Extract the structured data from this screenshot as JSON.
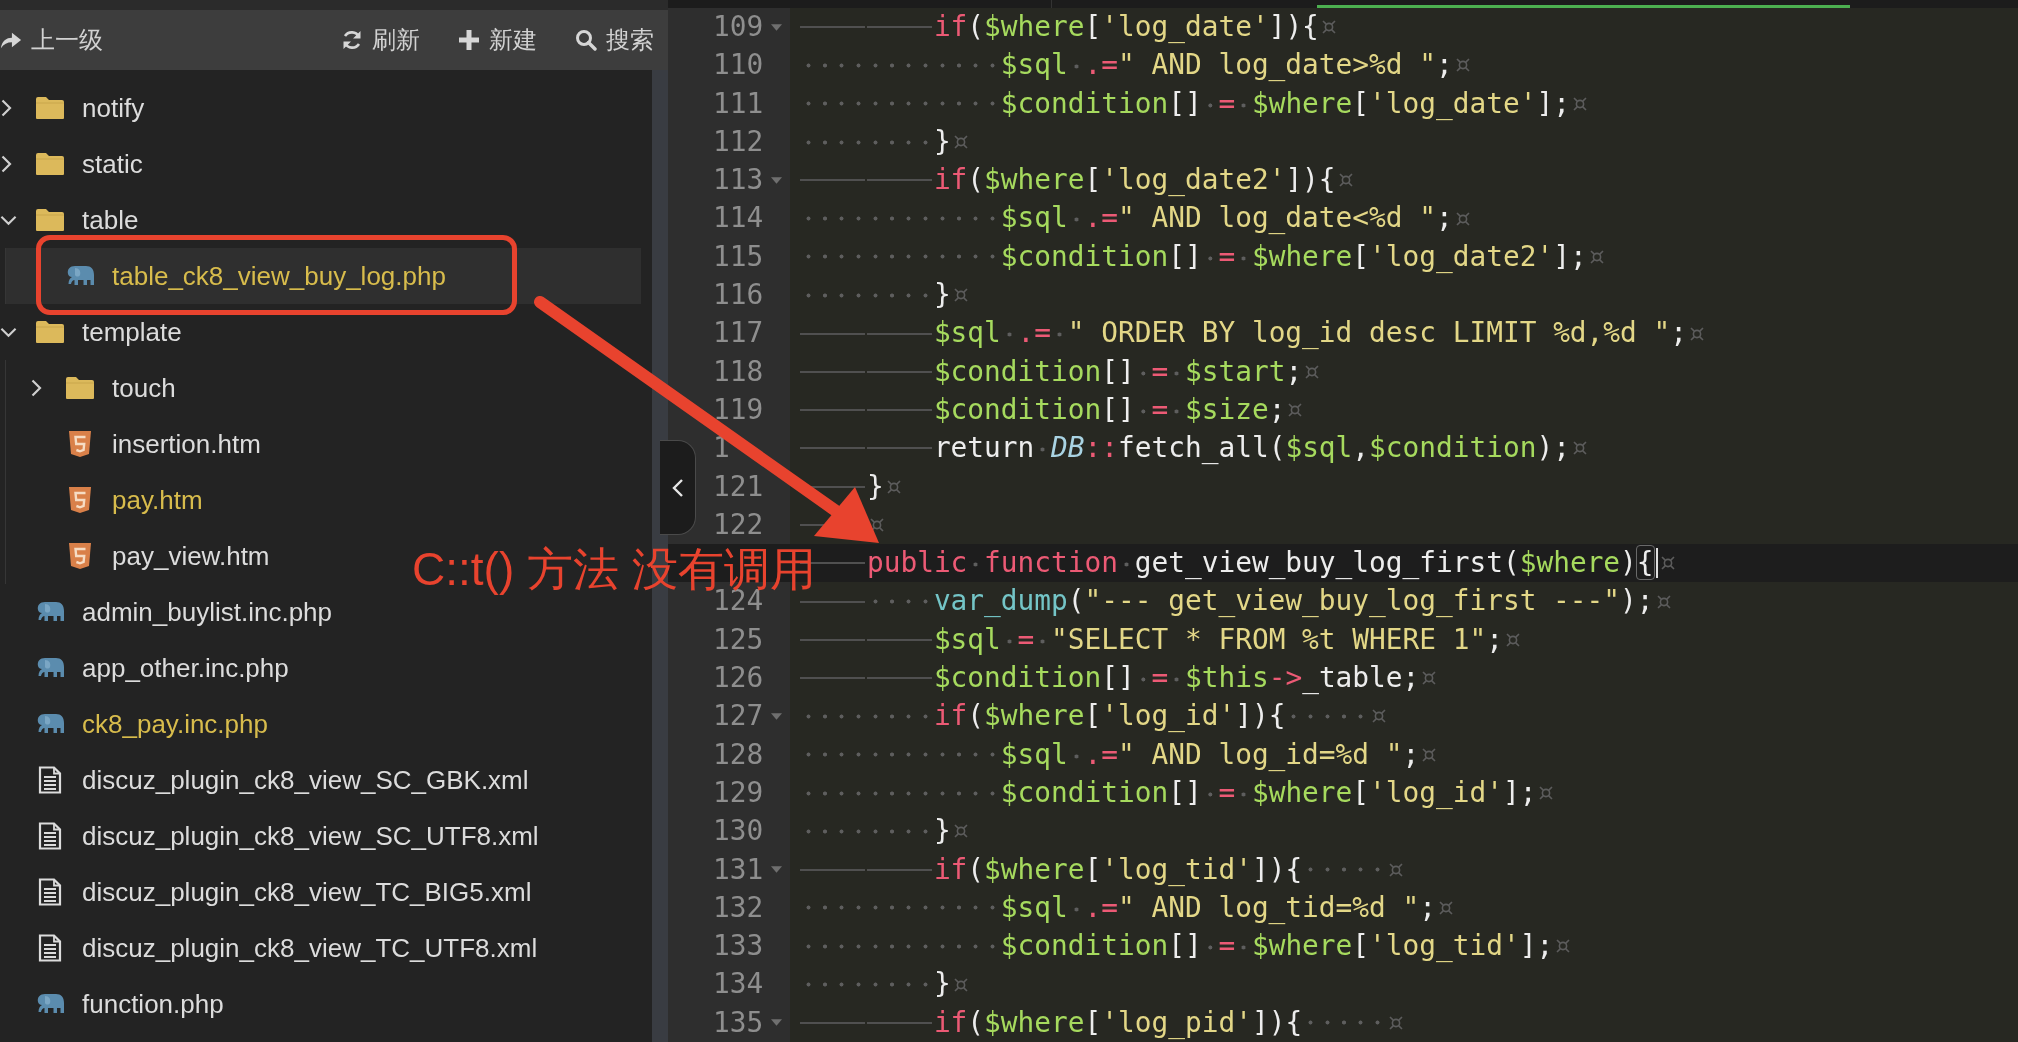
{
  "toolbar": {
    "actions": [
      {
        "kind": "up",
        "label": "上一级"
      },
      {
        "kind": "refresh",
        "label": "刷新"
      },
      {
        "kind": "new",
        "label": "新建"
      },
      {
        "kind": "search",
        "label": "搜索"
      }
    ]
  },
  "tree": [
    {
      "kind": "folder",
      "name": "notify",
      "expanded": false,
      "selected": false,
      "modified": false
    },
    {
      "kind": "folder",
      "name": "static",
      "expanded": false,
      "selected": false,
      "modified": false
    },
    {
      "kind": "folder",
      "name": "table",
      "expanded": true,
      "selected": false,
      "modified": false,
      "children": [
        {
          "kind": "php",
          "name": "table_ck8_view_buy_log.php",
          "selected": true,
          "modified": true
        }
      ]
    },
    {
      "kind": "folder",
      "name": "template",
      "expanded": true,
      "selected": false,
      "modified": false,
      "children": [
        {
          "kind": "folder",
          "name": "touch",
          "expanded": false,
          "selected": false,
          "modified": false
        },
        {
          "kind": "html",
          "name": "insertion.htm",
          "selected": false,
          "modified": false
        },
        {
          "kind": "html",
          "name": "pay.htm",
          "selected": false,
          "modified": true
        },
        {
          "kind": "html",
          "name": "pay_view.htm",
          "selected": false,
          "modified": false
        }
      ]
    },
    {
      "kind": "php",
      "name": "admin_buylist.inc.php",
      "selected": false,
      "modified": false
    },
    {
      "kind": "php",
      "name": "app_other.inc.php",
      "selected": false,
      "modified": false
    },
    {
      "kind": "php",
      "name": "ck8_pay.inc.php",
      "selected": false,
      "modified": true
    },
    {
      "kind": "xml",
      "name": "discuz_plugin_ck8_view_SC_GBK.xml",
      "selected": false,
      "modified": false
    },
    {
      "kind": "xml",
      "name": "discuz_plugin_ck8_view_SC_UTF8.xml",
      "selected": false,
      "modified": false
    },
    {
      "kind": "xml",
      "name": "discuz_plugin_ck8_view_TC_BIG5.xml",
      "selected": false,
      "modified": false
    },
    {
      "kind": "xml",
      "name": "discuz_plugin_ck8_view_TC_UTF8.xml",
      "selected": false,
      "modified": false
    },
    {
      "kind": "php",
      "name": "function.php",
      "selected": false,
      "modified": false
    }
  ],
  "editor": {
    "show_invisibles": true,
    "lines": [
      {
        "number": "109",
        "foldable": true,
        "active": false,
        "indent": [
          {
            "kind": "tab"
          },
          {
            "kind": "tab"
          }
        ],
        "tokens": [
          {
            "kind": "kw",
            "text": "if"
          },
          {
            "kind": "punc",
            "text": "("
          },
          {
            "kind": "var",
            "text": "$where"
          },
          {
            "kind": "punc",
            "text": "["
          },
          {
            "kind": "str",
            "text": "'log_date'"
          },
          {
            "kind": "punc",
            "text": "]){"
          }
        ]
      },
      {
        "number": "110",
        "foldable": false,
        "active": false,
        "indent": [
          {
            "kind": "space"
          },
          {
            "kind": "space"
          },
          {
            "kind": "space"
          },
          {
            "kind": "space"
          },
          {
            "kind": "space"
          },
          {
            "kind": "space"
          },
          {
            "kind": "space"
          },
          {
            "kind": "space"
          },
          {
            "kind": "space"
          },
          {
            "kind": "space"
          },
          {
            "kind": "space"
          },
          {
            "kind": "space"
          }
        ],
        "tokens": [
          {
            "kind": "var",
            "text": "$sql"
          },
          {
            "kind": "space"
          },
          {
            "kind": "op",
            "text": ".="
          },
          {
            "kind": "str",
            "text": "\" AND log_date>%d \""
          },
          {
            "kind": "punc",
            "text": ";"
          }
        ]
      },
      {
        "number": "111",
        "foldable": false,
        "active": false,
        "indent": [
          {
            "kind": "space"
          },
          {
            "kind": "space"
          },
          {
            "kind": "space"
          },
          {
            "kind": "space"
          },
          {
            "kind": "space"
          },
          {
            "kind": "space"
          },
          {
            "kind": "space"
          },
          {
            "kind": "space"
          },
          {
            "kind": "space"
          },
          {
            "kind": "space"
          },
          {
            "kind": "space"
          },
          {
            "kind": "space"
          }
        ],
        "tokens": [
          {
            "kind": "var",
            "text": "$condition"
          },
          {
            "kind": "punc",
            "text": "[]"
          },
          {
            "kind": "space"
          },
          {
            "kind": "op",
            "text": "="
          },
          {
            "kind": "space"
          },
          {
            "kind": "var",
            "text": "$where"
          },
          {
            "kind": "punc",
            "text": "["
          },
          {
            "kind": "str",
            "text": "'log_date'"
          },
          {
            "kind": "punc",
            "text": "];"
          }
        ]
      },
      {
        "number": "112",
        "foldable": false,
        "active": false,
        "indent": [
          {
            "kind": "space"
          },
          {
            "kind": "space"
          },
          {
            "kind": "space"
          },
          {
            "kind": "space"
          },
          {
            "kind": "space"
          },
          {
            "kind": "space"
          },
          {
            "kind": "space"
          },
          {
            "kind": "space"
          }
        ],
        "tokens": [
          {
            "kind": "punc",
            "text": "}"
          }
        ]
      },
      {
        "number": "113",
        "foldable": true,
        "active": false,
        "indent": [
          {
            "kind": "tab"
          },
          {
            "kind": "tab"
          }
        ],
        "tokens": [
          {
            "kind": "kw",
            "text": "if"
          },
          {
            "kind": "punc",
            "text": "("
          },
          {
            "kind": "var",
            "text": "$where"
          },
          {
            "kind": "punc",
            "text": "["
          },
          {
            "kind": "str",
            "text": "'log_date2'"
          },
          {
            "kind": "punc",
            "text": "]){"
          }
        ]
      },
      {
        "number": "114",
        "foldable": false,
        "active": false,
        "indent": [
          {
            "kind": "space"
          },
          {
            "kind": "space"
          },
          {
            "kind": "space"
          },
          {
            "kind": "space"
          },
          {
            "kind": "space"
          },
          {
            "kind": "space"
          },
          {
            "kind": "space"
          },
          {
            "kind": "space"
          },
          {
            "kind": "space"
          },
          {
            "kind": "space"
          },
          {
            "kind": "space"
          },
          {
            "kind": "space"
          }
        ],
        "tokens": [
          {
            "kind": "var",
            "text": "$sql"
          },
          {
            "kind": "space"
          },
          {
            "kind": "op",
            "text": ".="
          },
          {
            "kind": "str",
            "text": "\" AND log_date<%d \""
          },
          {
            "kind": "punc",
            "text": ";"
          }
        ]
      },
      {
        "number": "115",
        "foldable": false,
        "active": false,
        "indent": [
          {
            "kind": "space"
          },
          {
            "kind": "space"
          },
          {
            "kind": "space"
          },
          {
            "kind": "space"
          },
          {
            "kind": "space"
          },
          {
            "kind": "space"
          },
          {
            "kind": "space"
          },
          {
            "kind": "space"
          },
          {
            "kind": "space"
          },
          {
            "kind": "space"
          },
          {
            "kind": "space"
          },
          {
            "kind": "space"
          }
        ],
        "tokens": [
          {
            "kind": "var",
            "text": "$condition"
          },
          {
            "kind": "punc",
            "text": "[]"
          },
          {
            "kind": "space"
          },
          {
            "kind": "op",
            "text": "="
          },
          {
            "kind": "space"
          },
          {
            "kind": "var",
            "text": "$where"
          },
          {
            "kind": "punc",
            "text": "["
          },
          {
            "kind": "str",
            "text": "'log_date2'"
          },
          {
            "kind": "punc",
            "text": "];"
          }
        ]
      },
      {
        "number": "116",
        "foldable": false,
        "active": false,
        "indent": [
          {
            "kind": "space"
          },
          {
            "kind": "space"
          },
          {
            "kind": "space"
          },
          {
            "kind": "space"
          },
          {
            "kind": "space"
          },
          {
            "kind": "space"
          },
          {
            "kind": "space"
          },
          {
            "kind": "space"
          }
        ],
        "tokens": [
          {
            "kind": "punc",
            "text": "}"
          }
        ]
      },
      {
        "number": "117",
        "foldable": false,
        "active": false,
        "indent": [
          {
            "kind": "tab"
          },
          {
            "kind": "tab"
          }
        ],
        "tokens": [
          {
            "kind": "var",
            "text": "$sql"
          },
          {
            "kind": "space"
          },
          {
            "kind": "op",
            "text": ".="
          },
          {
            "kind": "space"
          },
          {
            "kind": "str",
            "text": "\" ORDER BY log_id desc LIMIT %d,%d \""
          },
          {
            "kind": "punc",
            "text": ";"
          }
        ]
      },
      {
        "number": "118",
        "foldable": false,
        "active": false,
        "indent": [
          {
            "kind": "tab"
          },
          {
            "kind": "tab"
          }
        ],
        "tokens": [
          {
            "kind": "var",
            "text": "$condition"
          },
          {
            "kind": "punc",
            "text": "[]"
          },
          {
            "kind": "space"
          },
          {
            "kind": "op",
            "text": "="
          },
          {
            "kind": "space"
          },
          {
            "kind": "var",
            "text": "$start"
          },
          {
            "kind": "punc",
            "text": ";"
          }
        ]
      },
      {
        "number": "119",
        "foldable": false,
        "active": false,
        "indent": [
          {
            "kind": "tab"
          },
          {
            "kind": "tab"
          }
        ],
        "tokens": [
          {
            "kind": "var",
            "text": "$condition"
          },
          {
            "kind": "punc",
            "text": "[]"
          },
          {
            "kind": "space"
          },
          {
            "kind": "op",
            "text": "="
          },
          {
            "kind": "space"
          },
          {
            "kind": "var",
            "text": "$size"
          },
          {
            "kind": "punc",
            "text": ";"
          }
        ]
      },
      {
        "number": "1",
        "foldable": false,
        "active": false,
        "indent": [
          {
            "kind": "tab"
          },
          {
            "kind": "tab"
          }
        ],
        "tokens": [
          {
            "kind": "plain",
            "text": "return"
          },
          {
            "kind": "space"
          },
          {
            "kind": "class",
            "text": "DB"
          },
          {
            "kind": "op",
            "text": "::"
          },
          {
            "kind": "plain",
            "text": "fetch_all"
          },
          {
            "kind": "punc",
            "text": "("
          },
          {
            "kind": "var",
            "text": "$sql"
          },
          {
            "kind": "punc",
            "text": ","
          },
          {
            "kind": "var",
            "text": "$condition"
          },
          {
            "kind": "punc",
            "text": ");"
          }
        ]
      },
      {
        "number": "121",
        "foldable": false,
        "active": false,
        "indent": [
          {
            "kind": "tab"
          }
        ],
        "tokens": [
          {
            "kind": "punc",
            "text": "}"
          }
        ]
      },
      {
        "number": "122",
        "foldable": false,
        "active": false,
        "indent": [
          {
            "kind": "tab"
          }
        ]
      },
      {
        "foldable": false,
        "active": true,
        "indent": [
          {
            "kind": "tab"
          }
        ],
        "tokens": [
          {
            "kind": "kw",
            "text": "public"
          },
          {
            "kind": "space"
          },
          {
            "kind": "kw",
            "text": "function"
          },
          {
            "kind": "space"
          },
          {
            "kind": "plain",
            "text": "get_view_buy_log_first"
          },
          {
            "kind": "punc",
            "text": "("
          },
          {
            "kind": "var",
            "text": "$where"
          },
          {
            "kind": "punc",
            "text": ")"
          },
          {
            "kind": "match",
            "text": "{"
          }
        ]
      },
      {
        "number": "124",
        "foldable": false,
        "active": false,
        "indent": [
          {
            "kind": "tab"
          },
          {
            "kind": "space"
          },
          {
            "kind": "space"
          },
          {
            "kind": "space"
          },
          {
            "kind": "space"
          }
        ],
        "tokens": [
          {
            "kind": "builtin",
            "text": "var_dump"
          },
          {
            "kind": "punc",
            "text": "("
          },
          {
            "kind": "str",
            "text": "\"--- get_view_buy_log_first ---\""
          },
          {
            "kind": "punc",
            "text": ");"
          }
        ]
      },
      {
        "number": "125",
        "foldable": false,
        "active": false,
        "indent": [
          {
            "kind": "tab"
          },
          {
            "kind": "tab"
          }
        ],
        "tokens": [
          {
            "kind": "var",
            "text": "$sql"
          },
          {
            "kind": "space"
          },
          {
            "kind": "op",
            "text": "="
          },
          {
            "kind": "space"
          },
          {
            "kind": "str",
            "text": "\"SELECT * FROM %t WHERE 1\""
          },
          {
            "kind": "punc",
            "text": ";"
          }
        ]
      },
      {
        "number": "126",
        "foldable": false,
        "active": false,
        "indent": [
          {
            "kind": "tab"
          },
          {
            "kind": "tab"
          }
        ],
        "tokens": [
          {
            "kind": "var",
            "text": "$condition"
          },
          {
            "kind": "punc",
            "text": "[]"
          },
          {
            "kind": "space"
          },
          {
            "kind": "op",
            "text": "="
          },
          {
            "kind": "space"
          },
          {
            "kind": "var",
            "text": "$this"
          },
          {
            "kind": "op",
            "text": "->"
          },
          {
            "kind": "plain",
            "text": "_table"
          },
          {
            "kind": "punc",
            "text": ";"
          }
        ]
      },
      {
        "number": "127",
        "foldable": true,
        "active": false,
        "indent": [
          {
            "kind": "space"
          },
          {
            "kind": "space"
          },
          {
            "kind": "space"
          },
          {
            "kind": "space"
          },
          {
            "kind": "space"
          },
          {
            "kind": "space"
          },
          {
            "kind": "space"
          },
          {
            "kind": "space"
          }
        ],
        "tokens": [
          {
            "kind": "kw",
            "text": "if"
          },
          {
            "kind": "punc",
            "text": "("
          },
          {
            "kind": "var",
            "text": "$where"
          },
          {
            "kind": "punc",
            "text": "["
          },
          {
            "kind": "str",
            "text": "'log_id'"
          },
          {
            "kind": "punc",
            "text": "]){"
          }
        ],
        "trailing": [
          {
            "kind": "space"
          },
          {
            "kind": "space"
          },
          {
            "kind": "space"
          },
          {
            "kind": "space"
          },
          {
            "kind": "space"
          }
        ]
      },
      {
        "number": "128",
        "foldable": false,
        "active": false,
        "indent": [
          {
            "kind": "space"
          },
          {
            "kind": "space"
          },
          {
            "kind": "space"
          },
          {
            "kind": "space"
          },
          {
            "kind": "space"
          },
          {
            "kind": "space"
          },
          {
            "kind": "space"
          },
          {
            "kind": "space"
          },
          {
            "kind": "space"
          },
          {
            "kind": "space"
          },
          {
            "kind": "space"
          },
          {
            "kind": "space"
          }
        ],
        "tokens": [
          {
            "kind": "var",
            "text": "$sql"
          },
          {
            "kind": "space"
          },
          {
            "kind": "op",
            "text": ".="
          },
          {
            "kind": "str",
            "text": "\" AND log_id=%d \""
          },
          {
            "kind": "punc",
            "text": ";"
          }
        ]
      },
      {
        "number": "129",
        "foldable": false,
        "active": false,
        "indent": [
          {
            "kind": "space"
          },
          {
            "kind": "space"
          },
          {
            "kind": "space"
          },
          {
            "kind": "space"
          },
          {
            "kind": "space"
          },
          {
            "kind": "space"
          },
          {
            "kind": "space"
          },
          {
            "kind": "space"
          },
          {
            "kind": "space"
          },
          {
            "kind": "space"
          },
          {
            "kind": "space"
          },
          {
            "kind": "space"
          }
        ],
        "tokens": [
          {
            "kind": "var",
            "text": "$condition"
          },
          {
            "kind": "punc",
            "text": "[]"
          },
          {
            "kind": "space"
          },
          {
            "kind": "op",
            "text": "="
          },
          {
            "kind": "space"
          },
          {
            "kind": "var",
            "text": "$where"
          },
          {
            "kind": "punc",
            "text": "["
          },
          {
            "kind": "str",
            "text": "'log_id'"
          },
          {
            "kind": "punc",
            "text": "];"
          }
        ]
      },
      {
        "number": "130",
        "foldable": false,
        "active": false,
        "indent": [
          {
            "kind": "space"
          },
          {
            "kind": "space"
          },
          {
            "kind": "space"
          },
          {
            "kind": "space"
          },
          {
            "kind": "space"
          },
          {
            "kind": "space"
          },
          {
            "kind": "space"
          },
          {
            "kind": "space"
          }
        ],
        "tokens": [
          {
            "kind": "punc",
            "text": "}"
          }
        ]
      },
      {
        "number": "131",
        "foldable": true,
        "active": false,
        "indent": [
          {
            "kind": "tab"
          },
          {
            "kind": "tab"
          }
        ],
        "tokens": [
          {
            "kind": "kw",
            "text": "if"
          },
          {
            "kind": "punc",
            "text": "("
          },
          {
            "kind": "var",
            "text": "$where"
          },
          {
            "kind": "punc",
            "text": "["
          },
          {
            "kind": "str",
            "text": "'log_tid'"
          },
          {
            "kind": "punc",
            "text": "]){"
          }
        ],
        "trailing": [
          {
            "kind": "space"
          },
          {
            "kind": "space"
          },
          {
            "kind": "space"
          },
          {
            "kind": "space"
          },
          {
            "kind": "space"
          }
        ]
      },
      {
        "number": "132",
        "foldable": false,
        "active": false,
        "indent": [
          {
            "kind": "space"
          },
          {
            "kind": "space"
          },
          {
            "kind": "space"
          },
          {
            "kind": "space"
          },
          {
            "kind": "space"
          },
          {
            "kind": "space"
          },
          {
            "kind": "space"
          },
          {
            "kind": "space"
          },
          {
            "kind": "space"
          },
          {
            "kind": "space"
          },
          {
            "kind": "space"
          },
          {
            "kind": "space"
          }
        ],
        "tokens": [
          {
            "kind": "var",
            "text": "$sql"
          },
          {
            "kind": "space"
          },
          {
            "kind": "op",
            "text": ".="
          },
          {
            "kind": "str",
            "text": "\" AND log_tid=%d \""
          },
          {
            "kind": "punc",
            "text": ";"
          }
        ]
      },
      {
        "number": "133",
        "foldable": false,
        "active": false,
        "indent": [
          {
            "kind": "space"
          },
          {
            "kind": "space"
          },
          {
            "kind": "space"
          },
          {
            "kind": "space"
          },
          {
            "kind": "space"
          },
          {
            "kind": "space"
          },
          {
            "kind": "space"
          },
          {
            "kind": "space"
          },
          {
            "kind": "space"
          },
          {
            "kind": "space"
          },
          {
            "kind": "space"
          },
          {
            "kind": "space"
          }
        ],
        "tokens": [
          {
            "kind": "var",
            "text": "$condition"
          },
          {
            "kind": "punc",
            "text": "[]"
          },
          {
            "kind": "space"
          },
          {
            "kind": "op",
            "text": "="
          },
          {
            "kind": "space"
          },
          {
            "kind": "var",
            "text": "$where"
          },
          {
            "kind": "punc",
            "text": "["
          },
          {
            "kind": "str",
            "text": "'log_tid'"
          },
          {
            "kind": "punc",
            "text": "];"
          }
        ]
      },
      {
        "number": "134",
        "foldable": false,
        "active": false,
        "indent": [
          {
            "kind": "space"
          },
          {
            "kind": "space"
          },
          {
            "kind": "space"
          },
          {
            "kind": "space"
          },
          {
            "kind": "space"
          },
          {
            "kind": "space"
          },
          {
            "kind": "space"
          },
          {
            "kind": "space"
          }
        ],
        "tokens": [
          {
            "kind": "punc",
            "text": "}"
          }
        ]
      },
      {
        "number": "135",
        "foldable": true,
        "active": false,
        "indent": [
          {
            "kind": "tab"
          },
          {
            "kind": "tab"
          }
        ],
        "tokens": [
          {
            "kind": "kw",
            "text": "if"
          },
          {
            "kind": "punc",
            "text": "("
          },
          {
            "kind": "var",
            "text": "$where"
          },
          {
            "kind": "punc",
            "text": "["
          },
          {
            "kind": "str",
            "text": "'log_pid'"
          },
          {
            "kind": "punc",
            "text": "]){"
          }
        ],
        "trailing": [
          {
            "kind": "space"
          },
          {
            "kind": "space"
          },
          {
            "kind": "space"
          },
          {
            "kind": "space"
          },
          {
            "kind": "space"
          }
        ]
      }
    ]
  },
  "annotation": {
    "text": "C::t() 方法 没有调用"
  }
}
